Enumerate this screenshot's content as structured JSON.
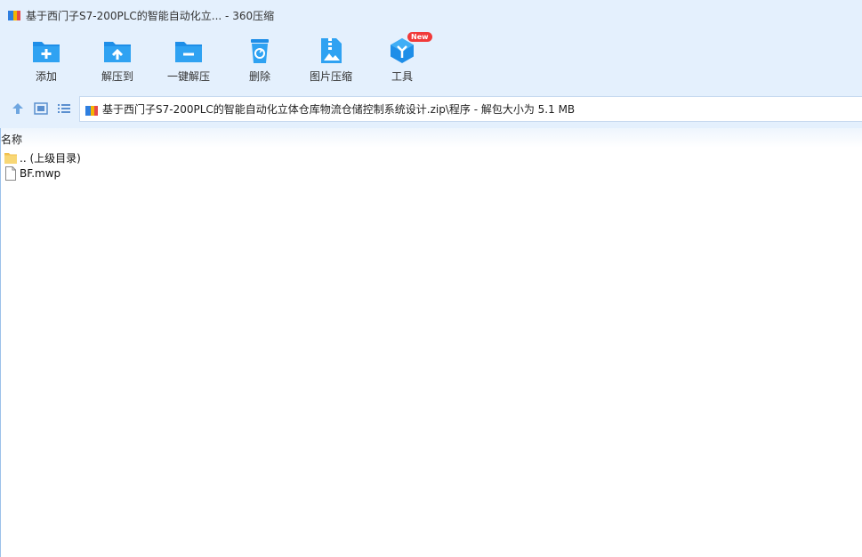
{
  "window": {
    "title": "基于西门子S7-200PLC的智能自动化立... - 360压缩"
  },
  "toolbar": {
    "items": [
      {
        "label": "添加",
        "icon": "add-folder-icon"
      },
      {
        "label": "解压到",
        "icon": "extract-to-icon"
      },
      {
        "label": "一键解压",
        "icon": "one-click-extract-icon"
      },
      {
        "label": "删除",
        "icon": "delete-icon"
      },
      {
        "label": "图片压缩",
        "icon": "image-compress-icon"
      },
      {
        "label": "工具",
        "icon": "tools-icon",
        "badge": "New"
      }
    ]
  },
  "navbar": {
    "path": "基于西门子S7-200PLC的智能自动化立体仓库物流仓储控制系统设计.zip\\程序 - 解包大小为 5.1 MB"
  },
  "filelist": {
    "column_name": "名称",
    "rows": [
      {
        "label": ".. (上级目录)",
        "icon": "folder-icon"
      },
      {
        "label": "BF.mwp",
        "icon": "file-icon"
      }
    ]
  },
  "colors": {
    "chrome_bg": "#e4f0fd",
    "icon_blue": "#1e8ee8",
    "badge_red": "#f13a3a"
  }
}
